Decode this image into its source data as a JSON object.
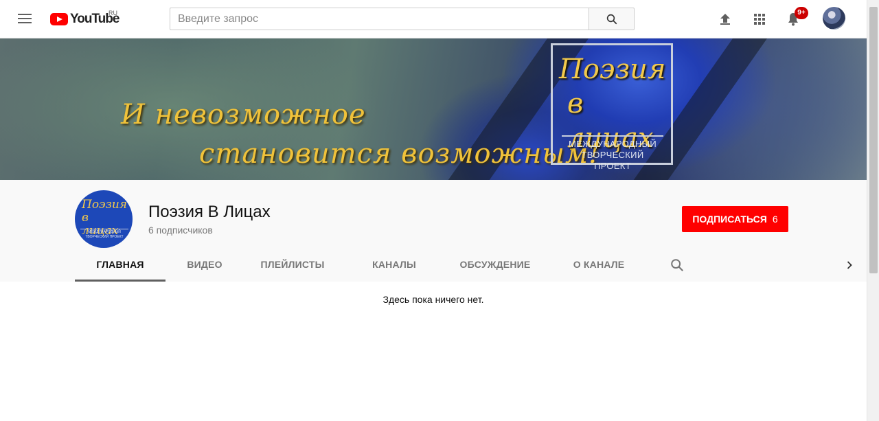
{
  "header": {
    "logo_text": "YouTube",
    "logo_region": "RU",
    "search_placeholder": "Введите запрос",
    "notification_badge": "9+"
  },
  "banner": {
    "slogan_line1": "И невозможное",
    "slogan_line2": "становится возможным!",
    "logo_title_line1": "Поэзия",
    "logo_title_line2": "в лицах",
    "logo_subtitle_line1": "МЕЖДУНАРОДНЫЙ",
    "logo_subtitle_line2": "ТВОРЧЕСКИЙ ПРОЕКТ"
  },
  "channel": {
    "name": "Поэзия В Лицах",
    "subscribers": "6 подписчиков",
    "subscribe_label": "ПОДПИСАТЬСЯ",
    "subscribe_count": "6",
    "avatar_title_line1": "Поэзия",
    "avatar_title_line2": "в лицах",
    "avatar_subtitle": "МЕЖДУНАРОДНЫЙ ТВОРЧЕСКИЙ ПРОЕКТ"
  },
  "tabs": [
    {
      "label": "ГЛАВНАЯ",
      "active": true
    },
    {
      "label": "ВИДЕО",
      "active": false
    },
    {
      "label": "ПЛЕЙЛИСТЫ",
      "active": false
    },
    {
      "label": "КАНАЛЫ",
      "active": false
    },
    {
      "label": "ОБСУЖДЕНИЕ",
      "active": false
    },
    {
      "label": "О КАНАЛЕ",
      "active": false
    }
  ],
  "content": {
    "empty_message": "Здесь пока ничего нет."
  },
  "icons": {
    "menu": "hamburger-menu-icon",
    "search": "search-icon",
    "upload": "upload-icon",
    "apps": "apps-grid-icon",
    "notifications": "bell-icon",
    "next": "chevron-right-icon"
  },
  "colors": {
    "brand_red": "#ff0000",
    "badge_red": "#cc0000",
    "banner_gold": "#f0c23a"
  }
}
